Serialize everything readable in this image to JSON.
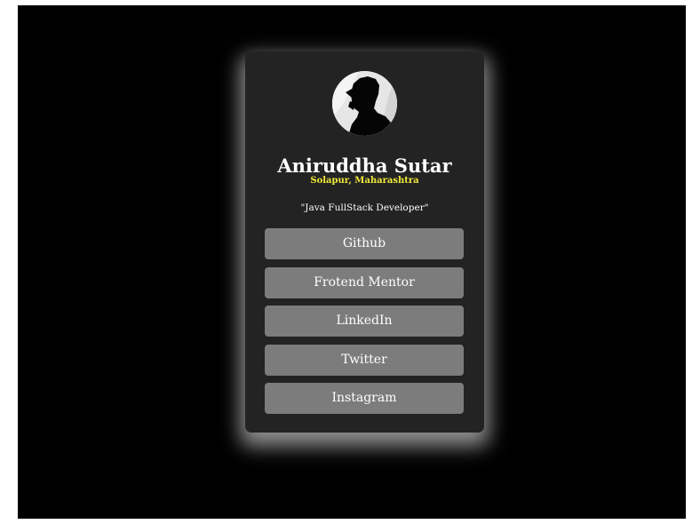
{
  "profile": {
    "avatar_icon": "person-silhouette-icon",
    "name": "Aniruddha Sutar",
    "location": "Solapur, Maharashtra",
    "tagline": "\"Java FullStack Developer\""
  },
  "links": [
    {
      "label": "Github"
    },
    {
      "label": "Frotend Mentor"
    },
    {
      "label": "LinkedIn"
    },
    {
      "label": "Twitter"
    },
    {
      "label": "Instagram"
    }
  ],
  "colors": {
    "background": "#000000",
    "card": "#232323",
    "button": "#7c7c7c",
    "accent_location": "#f1ea3a",
    "text": "#ffffff"
  }
}
